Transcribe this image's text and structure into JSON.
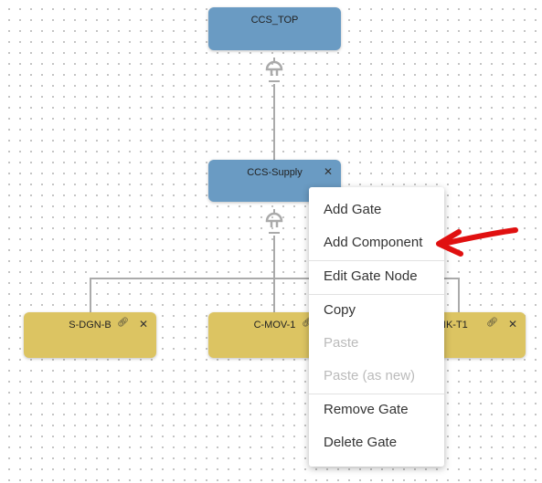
{
  "nodes": {
    "top": {
      "label": "CCS_TOP"
    },
    "supply": {
      "label": "CCS-Supply",
      "close": "✕"
    },
    "children": [
      {
        "label": "S-DGN-B",
        "link": "🔗",
        "close": "✕"
      },
      {
        "label": "C-MOV-1",
        "link": "🔗",
        "close": "✕"
      },
      {
        "label": "NK-T1",
        "link": "🔗",
        "close": "✕"
      }
    ]
  },
  "colors": {
    "gate": "#6a9bc3",
    "component": "#dcc462",
    "arrow": "#e01010"
  },
  "context_menu": {
    "items": [
      {
        "label": "Add Gate",
        "enabled": true
      },
      {
        "label": "Add Component",
        "enabled": true
      },
      {
        "label": "Edit Gate Node",
        "enabled": true
      },
      {
        "label": "Copy",
        "enabled": true
      },
      {
        "label": "Paste",
        "enabled": false
      },
      {
        "label": "Paste (as new)",
        "enabled": false
      },
      {
        "label": "Remove Gate",
        "enabled": true
      },
      {
        "label": "Delete Gate",
        "enabled": true
      }
    ]
  }
}
